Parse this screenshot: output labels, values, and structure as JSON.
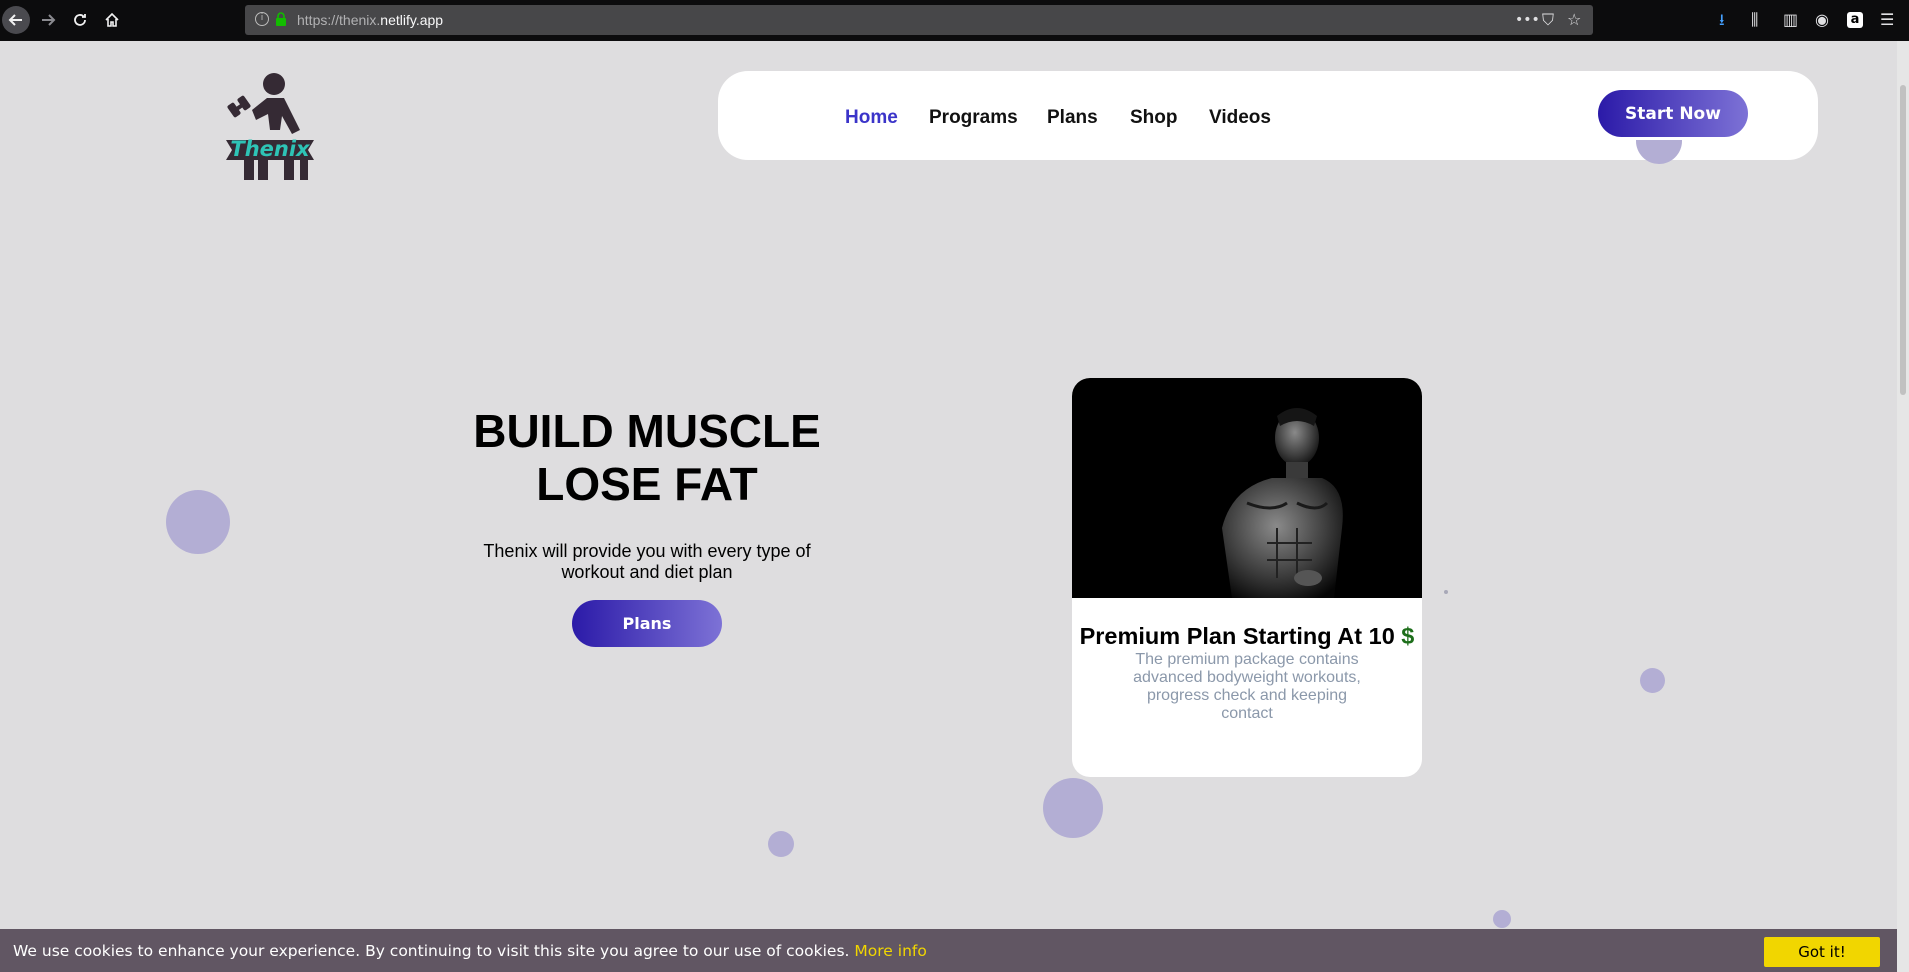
{
  "browser": {
    "url_prefix": "https://thenix.",
    "url_domain": "netlify.app",
    "back_icon": "arrow-left-icon",
    "forward_icon": "arrow-right-icon",
    "reload_icon": "reload-icon",
    "home_icon": "home-icon",
    "more_glyph": "•••",
    "pocket_glyph": "⛉",
    "star_glyph": "☆",
    "download_glyph": "⭳",
    "library_glyph": "⫼",
    "sidebar_glyph": "▥",
    "account_glyph": "◉",
    "amazon_glyph": "a",
    "menu_glyph": "☰"
  },
  "logo": {
    "text": "Thenix"
  },
  "nav": {
    "items": [
      {
        "label": "Home",
        "active": true
      },
      {
        "label": "Programs"
      },
      {
        "label": "Plans"
      },
      {
        "label": "Shop"
      },
      {
        "label": "Videos"
      }
    ],
    "cta": "Start Now"
  },
  "hero": {
    "title_line1": "BUILD MUSCLE",
    "title_line2": "LOSE FAT",
    "subtitle": "Thenix will provide you with every type of workout and diet plan",
    "button": "Plans"
  },
  "card": {
    "title": "Premium Plan Starting At 10",
    "currency": "$",
    "description": "The premium package contains advanced bodyweight workouts, progress check and keeping contact"
  },
  "cookie": {
    "text": "We use cookies to enhance your experience. By continuing to visit this site you agree to our use of cookies.",
    "more": "More info",
    "button": "Got it!"
  },
  "colors": {
    "page_bg": "#dedddf",
    "accent": "#3b34c9",
    "gradient_start": "#2b1aa8",
    "gradient_end": "#7d72d6",
    "bubble": "#b3aed4",
    "cookie_bg": "#615663",
    "cookie_accent": "#f1d600"
  }
}
